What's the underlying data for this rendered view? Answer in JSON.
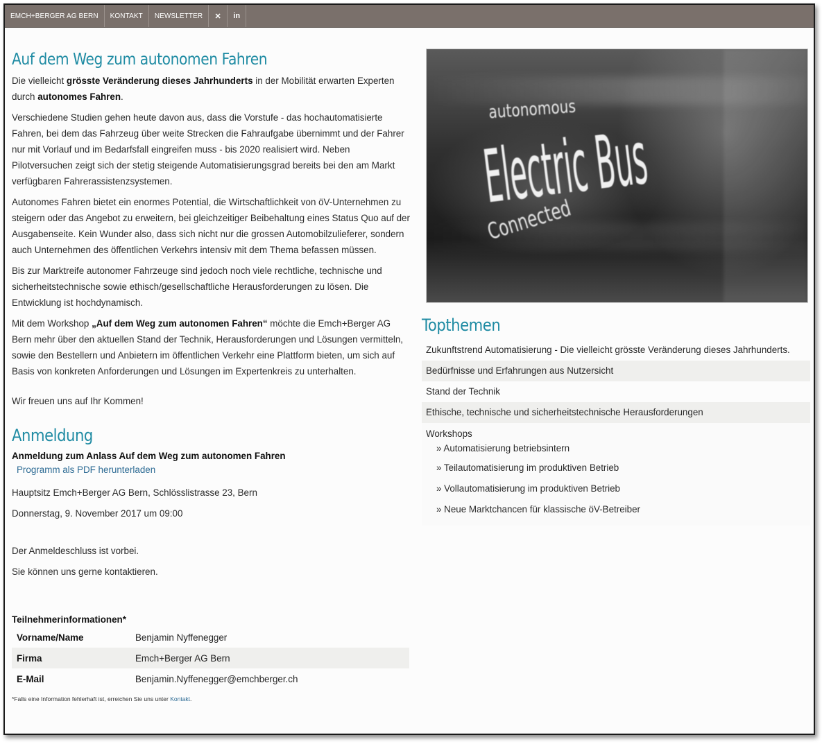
{
  "nav": {
    "items": [
      "EMCH+BERGER AG BERN",
      "KONTAKT",
      "NEWSLETTER"
    ],
    "icons": [
      {
        "name": "xing-icon",
        "glyph": "✕"
      },
      {
        "name": "linkedin-icon",
        "glyph": "in"
      }
    ]
  },
  "article": {
    "title": "Auf dem Weg zum autonomen Fahren",
    "p1_pre": "Die vielleicht ",
    "p1_bold": "grösste Veränderung dieses Jahrhunderts",
    "p1_mid": " in der Mobilität erwarten Experten durch ",
    "p1_bold2": "autonomes Fahren",
    "p1_end": ".",
    "p2": "Verschiedene Studien gehen heute davon aus, dass die Vorstufe - das hochautomatisierte Fahren, bei dem das Fahrzeug über weite Strecken die Fahraufgabe übernimmt und der Fahrer nur mit Vorlauf und im Bedarfsfall eingreifen muss - bis 2020 realisiert wird. Neben Pilotversuchen zeigt sich der stetig steigende Automatisierungsgrad bereits bei den am Markt verfügbaren Fahrerassistenzsystemen.",
    "p3": "Autonomes Fahren bietet ein enormes Potential, die Wirtschaftlichkeit von öV-Unternehmen zu steigern oder das Angebot zu erweitern, bei gleichzeitiger Beibehaltung eines Status Quo auf der Ausgabenseite. Kein Wunder also, dass sich nicht nur die grossen Automobilzulieferer, sondern auch Unternehmen des öffentlichen Verkehrs intensiv mit dem Thema befassen müssen.",
    "p4": "Bis zur Marktreife autonomer Fahrzeuge sind jedoch noch viele rechtliche, technische und sicherheitstechnische sowie ethisch/gesellschaftliche Herausforderungen zu lösen. Die Entwicklung ist hochdynamisch.",
    "p5_pre": "Mit dem Workshop ",
    "p5_bold": "„Auf dem Weg zum autonomen Fahren“",
    "p5_post": " möchte die Emch+Berger AG Bern mehr über den aktuellen Stand der Technik, Herausforderungen und Lösungen vermitteln, sowie den Bestellern und Anbietern im öffentlichen Verkehr eine Plattform bieten, um sich auf Basis von konkreten Anforderungen und Lösungen im Expertenkreis zu unterhalten.",
    "p6": "Wir freuen uns auf Ihr Kommen!"
  },
  "registration": {
    "title": "Anmeldung",
    "event_title": "Anmeldung zum Anlass Auf dem Weg zum autonomen Fahren",
    "pdf_link": "Programm als PDF herunterladen",
    "location": "Hauptsitz Emch+Berger AG Bern, Schlösslistrasse 23, Bern",
    "date": "Donnerstag, 9. November 2017 um 09:00",
    "closed": "Der Anmeldeschluss ist vorbei.",
    "contact": "Sie können uns gerne kontaktieren."
  },
  "participant": {
    "label": "Teilnehmerinformationen*",
    "rows": [
      {
        "label": "Vorname/Name",
        "value": "Benjamin Nyffenegger"
      },
      {
        "label": "Firma",
        "value": "Emch+Berger AG Bern"
      },
      {
        "label": "E-Mail",
        "value": "Benjamin.Nyffenegger@emchberger.ch"
      }
    ],
    "footnote_pre": "*Falls eine Information fehlerhaft ist, erreichen Sie uns unter ",
    "footnote_link": "Kontakt",
    "footnote_post": "."
  },
  "hero": {
    "line1": "autonomous",
    "line2": "Electric Bus",
    "line3": "Connected"
  },
  "topthemen": {
    "title": "Topthemen",
    "items": [
      "Zukunftstrend Automatisierung - Die vielleicht grösste Veränderung dieses Jahrhunderts.",
      "Bedürfnisse und Erfahrungen aus Nutzersicht",
      "Stand der Technik",
      "Ethische, technische und sicherheitstechnische Herausforderungen"
    ],
    "workshops_label": "Workshops",
    "workshops": [
      "» Automatisierung betriebsintern",
      "» Teilautomatisierung im produktiven Betrieb",
      "» Vollautomatisierung im produktiven Betrieb",
      "» Neue Marktchancen für klassische öV-Betreiber"
    ]
  }
}
